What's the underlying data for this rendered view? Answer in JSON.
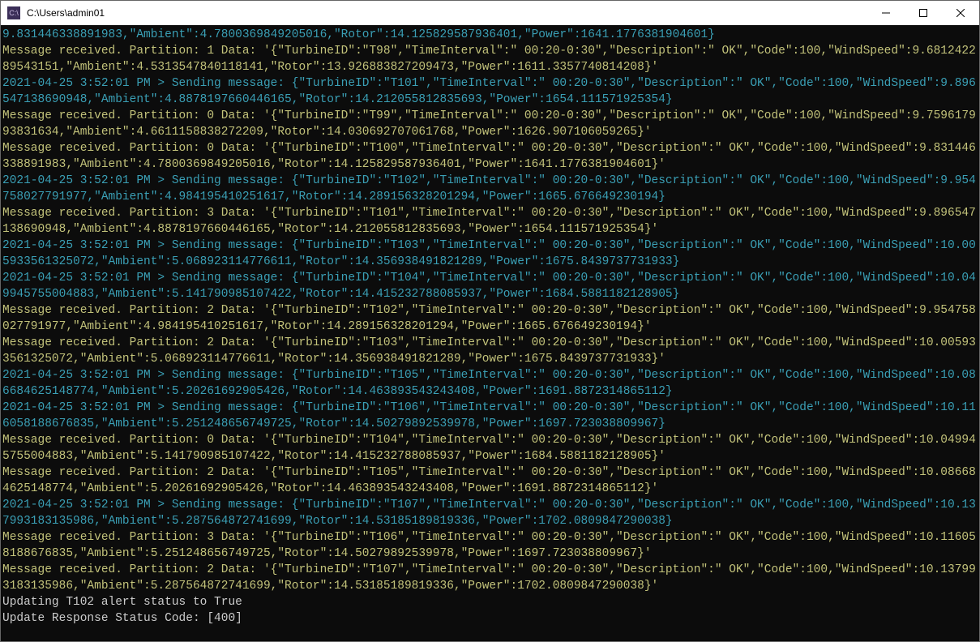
{
  "window": {
    "title": "C:\\Users\\admin01"
  },
  "lines": [
    {
      "cls": "l-cyan",
      "text": "9.831446338891983,\"Ambient\":4.7800369849205016,\"Rotor\":14.125829587936401,\"Power\":1641.1776381904601}"
    },
    {
      "cls": "l-yellow",
      "text": "Message received. Partition: 1 Data: '{\"TurbineID\":\"T98\",\"TimeInterval\":\" 00:20-0:30\",\"Description\":\" OK\",\"Code\":100,\"WindSpeed\":9.681242289543151,\"Ambient\":4.5313547840118141,\"Rotor\":13.926883827209473,\"Power\":1611.3357740814208}'"
    },
    {
      "cls": "l-cyan",
      "text": "2021-04-25 3:52:01 PM > Sending message: {\"TurbineID\":\"T101\",\"TimeInterval\":\" 00:20-0:30\",\"Description\":\" OK\",\"Code\":100,\"WindSpeed\":9.896547138690948,\"Ambient\":4.8878197660446165,\"Rotor\":14.212055812835693,\"Power\":1654.111571925354}"
    },
    {
      "cls": "l-yellow",
      "text": "Message received. Partition: 0 Data: '{\"TurbineID\":\"T99\",\"TimeInterval\":\" 00:20-0:30\",\"Description\":\" OK\",\"Code\":100,\"WindSpeed\":9.759617993831634,\"Ambient\":4.6611158838272209,\"Rotor\":14.030692707061768,\"Power\":1626.907106059265}'"
    },
    {
      "cls": "l-yellow",
      "text": "Message received. Partition: 0 Data: '{\"TurbineID\":\"T100\",\"TimeInterval\":\" 00:20-0:30\",\"Description\":\" OK\",\"Code\":100,\"WindSpeed\":9.831446338891983,\"Ambient\":4.7800369849205016,\"Rotor\":14.125829587936401,\"Power\":1641.1776381904601}'"
    },
    {
      "cls": "l-cyan",
      "text": "2021-04-25 3:52:01 PM > Sending message: {\"TurbineID\":\"T102\",\"TimeInterval\":\" 00:20-0:30\",\"Description\":\" OK\",\"Code\":100,\"WindSpeed\":9.954758027791977,\"Ambient\":4.984195410251617,\"Rotor\":14.289156328201294,\"Power\":1665.676649230194}"
    },
    {
      "cls": "l-yellow",
      "text": "Message received. Partition: 3 Data: '{\"TurbineID\":\"T101\",\"TimeInterval\":\" 00:20-0:30\",\"Description\":\" OK\",\"Code\":100,\"WindSpeed\":9.896547138690948,\"Ambient\":4.8878197660446165,\"Rotor\":14.212055812835693,\"Power\":1654.111571925354}'"
    },
    {
      "cls": "l-cyan",
      "text": "2021-04-25 3:52:01 PM > Sending message: {\"TurbineID\":\"T103\",\"TimeInterval\":\" 00:20-0:30\",\"Description\":\" OK\",\"Code\":100,\"WindSpeed\":10.005933561325072,\"Ambient\":5.068923114776611,\"Rotor\":14.356938491821289,\"Power\":1675.8439737731933}"
    },
    {
      "cls": "l-cyan",
      "text": "2021-04-25 3:52:01 PM > Sending message: {\"TurbineID\":\"T104\",\"TimeInterval\":\" 00:20-0:30\",\"Description\":\" OK\",\"Code\":100,\"WindSpeed\":10.049945755004883,\"Ambient\":5.141790985107422,\"Rotor\":14.415232788085937,\"Power\":1684.5881182128905}"
    },
    {
      "cls": "l-yellow",
      "text": "Message received. Partition: 2 Data: '{\"TurbineID\":\"T102\",\"TimeInterval\":\" 00:20-0:30\",\"Description\":\" OK\",\"Code\":100,\"WindSpeed\":9.954758027791977,\"Ambient\":4.984195410251617,\"Rotor\":14.289156328201294,\"Power\":1665.676649230194}'"
    },
    {
      "cls": "l-yellow",
      "text": "Message received. Partition: 2 Data: '{\"TurbineID\":\"T103\",\"TimeInterval\":\" 00:20-0:30\",\"Description\":\" OK\",\"Code\":100,\"WindSpeed\":10.005933561325072,\"Ambient\":5.068923114776611,\"Rotor\":14.356938491821289,\"Power\":1675.8439737731933}'"
    },
    {
      "cls": "l-cyan",
      "text": "2021-04-25 3:52:01 PM > Sending message: {\"TurbineID\":\"T105\",\"TimeInterval\":\" 00:20-0:30\",\"Description\":\" OK\",\"Code\":100,\"WindSpeed\":10.086684625148774,\"Ambient\":5.20261692905426,\"Rotor\":14.463893543243408,\"Power\":1691.8872314865112}"
    },
    {
      "cls": "l-cyan",
      "text": "2021-04-25 3:52:01 PM > Sending message: {\"TurbineID\":\"T106\",\"TimeInterval\":\" 00:20-0:30\",\"Description\":\" OK\",\"Code\":100,\"WindSpeed\":10.116058188676835,\"Ambient\":5.251248656749725,\"Rotor\":14.50279892539978,\"Power\":1697.723038809967}"
    },
    {
      "cls": "l-yellow",
      "text": "Message received. Partition: 0 Data: '{\"TurbineID\":\"T104\",\"TimeInterval\":\" 00:20-0:30\",\"Description\":\" OK\",\"Code\":100,\"WindSpeed\":10.049945755004883,\"Ambient\":5.141790985107422,\"Rotor\":14.415232788085937,\"Power\":1684.5881182128905}'"
    },
    {
      "cls": "l-yellow",
      "text": "Message received. Partition: 2 Data: '{\"TurbineID\":\"T105\",\"TimeInterval\":\" 00:20-0:30\",\"Description\":\" OK\",\"Code\":100,\"WindSpeed\":10.086684625148774,\"Ambient\":5.20261692905426,\"Rotor\":14.463893543243408,\"Power\":1691.8872314865112}'"
    },
    {
      "cls": "l-cyan",
      "text": "2021-04-25 3:52:01 PM > Sending message: {\"TurbineID\":\"T107\",\"TimeInterval\":\" 00:20-0:30\",\"Description\":\" OK\",\"Code\":100,\"WindSpeed\":10.137993183135986,\"Ambient\":5.287564872741699,\"Rotor\":14.53185189819336,\"Power\":1702.0809847290038}"
    },
    {
      "cls": "l-yellow",
      "text": "Message received. Partition: 3 Data: '{\"TurbineID\":\"T106\",\"TimeInterval\":\" 00:20-0:30\",\"Description\":\" OK\",\"Code\":100,\"WindSpeed\":10.116058188676835,\"Ambient\":5.251248656749725,\"Rotor\":14.50279892539978,\"Power\":1697.723038809967}'"
    },
    {
      "cls": "l-yellow",
      "text": "Message received. Partition: 2 Data: '{\"TurbineID\":\"T107\",\"TimeInterval\":\" 00:20-0:30\",\"Description\":\" OK\",\"Code\":100,\"WindSpeed\":10.137993183135986,\"Ambient\":5.287564872741699,\"Rotor\":14.53185189819336,\"Power\":1702.0809847290038}'"
    },
    {
      "cls": "l-white",
      "text": "Updating T102 alert status to True"
    },
    {
      "cls": "l-white",
      "text": "Update Response Status Code: [400]"
    }
  ]
}
